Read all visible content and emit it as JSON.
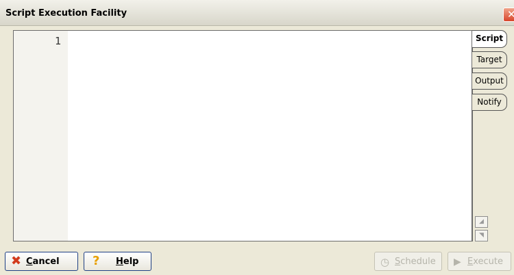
{
  "window": {
    "title": "Script Execution Facility",
    "close_glyph": "✕"
  },
  "editor": {
    "line_numbers": [
      "1"
    ],
    "content": ""
  },
  "tabs": [
    {
      "label": "Script",
      "active": true
    },
    {
      "label": "Target",
      "active": false
    },
    {
      "label": "Output",
      "active": false
    },
    {
      "label": "Notify",
      "active": false
    }
  ],
  "buttons": {
    "cancel": {
      "first": "C",
      "rest": "ancel",
      "icon": "✖"
    },
    "help": {
      "first": "H",
      "rest": "elp",
      "icon": "?"
    },
    "schedule": {
      "first": "S",
      "rest": "chedule",
      "icon": "◷"
    },
    "execute": {
      "first": "E",
      "rest": "xecute",
      "icon": "▶"
    }
  },
  "colors": {
    "accent_border": "#1e3f83",
    "close": "#d8452a",
    "cancel_icon": "#d23b1c",
    "help_icon": "#e8a000"
  }
}
